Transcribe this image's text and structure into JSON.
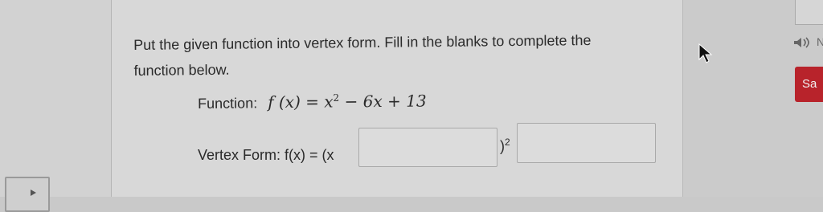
{
  "question": {
    "line1": "Put the given function into vertex form.  Fill in the blanks to complete the",
    "line2": "function below."
  },
  "function": {
    "label": "Function:",
    "lhs": "f (x) = x",
    "exponent": "2",
    "rest": " − 6x + 13"
  },
  "vertex_form": {
    "label": "Vertex Form:",
    "prefix": "f(x) = (x",
    "suffix": ")",
    "exponent": "2",
    "blank1_value": "",
    "blank2_value": ""
  },
  "sidebar": {
    "save_label": "Sa",
    "n_label": "N"
  },
  "icons": {
    "cursor": "arrow-cursor-icon",
    "audio": "speaker-icon",
    "left": "play-triangle-icon"
  },
  "colors": {
    "save_button": "#b8232b"
  }
}
